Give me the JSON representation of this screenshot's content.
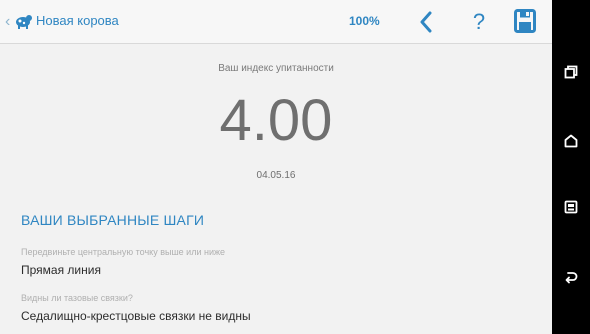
{
  "header": {
    "title": "Новая корова",
    "zoom": "100%",
    "help_label": "?",
    "icons": {
      "back": "chevron-left-icon",
      "app": "cow-icon",
      "nav_back": "chevron-left-icon",
      "help": "question-icon",
      "save": "floppy-disk-icon"
    }
  },
  "score": {
    "label": "Ваш индекс упитанности",
    "value": "4.00",
    "date": "04.05.16"
  },
  "steps": {
    "heading": "ВАШИ ВЫБРАННЫЕ ШАГИ",
    "items": [
      {
        "question": "Передвиньте центральную точку выше или ниже",
        "answer": "Прямая линия"
      },
      {
        "question": "Видны ли тазовые связки?",
        "answer": "Седалищно-крестцовые связки не видны"
      }
    ]
  },
  "system_nav": {
    "icons": [
      "recent-apps-icon",
      "home-icon",
      "screenshot-icon",
      "return-icon"
    ]
  },
  "colors": {
    "accent": "#2f86c2",
    "score_text": "#6f6f6f",
    "hint_text": "#b0b0b0",
    "navbar": "#000000"
  }
}
